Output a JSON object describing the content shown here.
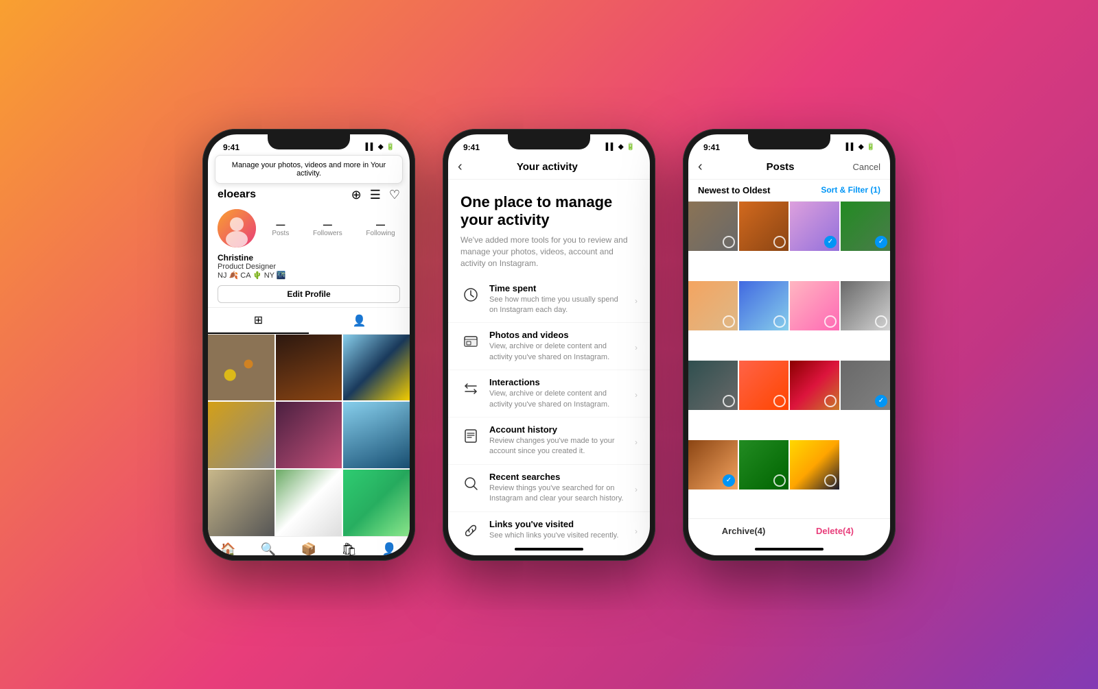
{
  "background": {
    "gradient": "linear-gradient(135deg, #f9a030 0%, #e83d7a 50%, #c13584 75%, #833ab4 100%)"
  },
  "phone1": {
    "status_time": "9:41",
    "status_icons": "▌▌ ✦ ▐▐",
    "tooltip": "Manage your photos, videos and more in Your activity.",
    "username": "eloears",
    "profile_name": "Christine",
    "profile_bio1": "Product Designer",
    "profile_bio2": "NJ 🍂 CA 🌵 NY 🌃",
    "stats": [
      {
        "num": "",
        "label": "Posts"
      },
      {
        "num": "",
        "label": "Followers"
      },
      {
        "num": "",
        "label": "Following"
      }
    ],
    "edit_btn": "Edit Profile",
    "nav_items": [
      "🏠",
      "🔍",
      "📦",
      "🛍",
      "👤"
    ]
  },
  "phone2": {
    "status_time": "9:41",
    "screen_title": "Your activity",
    "hero_title": "One place to manage your activity",
    "hero_sub": "We've added more tools for you to review and manage your photos, videos, account and activity on Instagram.",
    "items": [
      {
        "icon": "⏱",
        "name": "Time spent",
        "desc": "See how much time you usually spend on Instagram each day."
      },
      {
        "icon": "🖼",
        "name": "Photos and videos",
        "desc": "View, archive or delete content and activity you've shared on Instagram."
      },
      {
        "icon": "↔",
        "name": "Interactions",
        "desc": "View, archive or delete content and activity you've shared on Instagram."
      },
      {
        "icon": "📅",
        "name": "Account history",
        "desc": "Review changes you've made to your account since you created it."
      },
      {
        "icon": "🔍",
        "name": "Recent searches",
        "desc": "Review things you've searched for on Instagram and clear your search history."
      },
      {
        "icon": "🔗",
        "name": "Links you've visited",
        "desc": "See which links you've visited recently."
      }
    ]
  },
  "phone3": {
    "status_time": "9:41",
    "screen_title": "Posts",
    "cancel_label": "Cancel",
    "sort_label": "Newest to Oldest",
    "sort_filter": "Sort & Filter (1)",
    "archive_btn": "Archive(4)",
    "delete_btn": "Delete(4)",
    "grid": [
      {
        "color": "pg1",
        "checked": false
      },
      {
        "color": "pg2",
        "checked": false
      },
      {
        "color": "pg3",
        "checked": true
      },
      {
        "color": "pg4",
        "checked": true
      },
      {
        "color": "pg5",
        "checked": false
      },
      {
        "color": "pg6",
        "checked": false
      },
      {
        "color": "pg7",
        "checked": false
      },
      {
        "color": "pg8",
        "checked": false
      },
      {
        "color": "pg9",
        "checked": false
      },
      {
        "color": "pg10",
        "checked": false
      },
      {
        "color": "pg11",
        "checked": false
      },
      {
        "color": "pg12",
        "checked": true
      },
      {
        "color": "pg13",
        "checked": false
      },
      {
        "color": "pg14",
        "checked": false
      },
      {
        "color": "pg15",
        "checked": false
      },
      {
        "color": "",
        "checked": true
      }
    ]
  }
}
